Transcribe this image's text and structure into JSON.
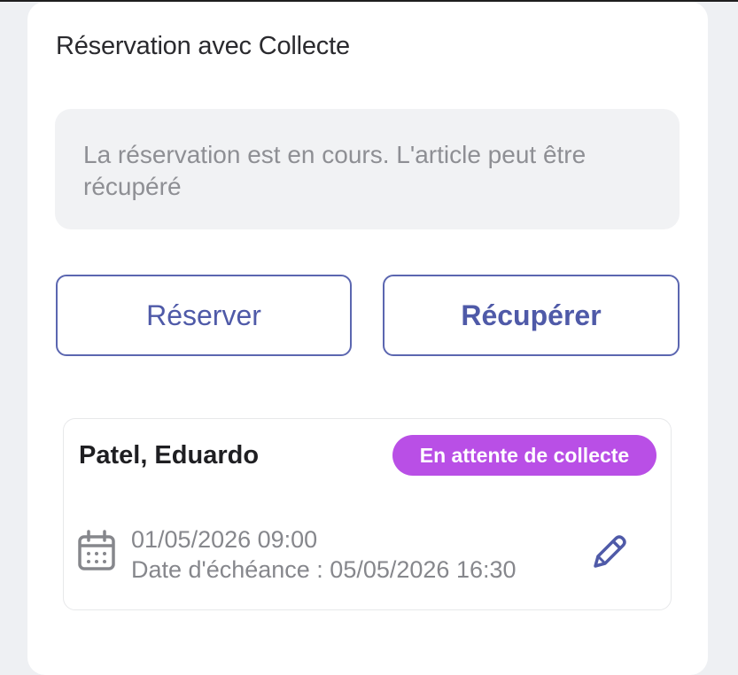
{
  "panel": {
    "title": "Réservation avec Collecte",
    "info_message": "La réservation est en cours. L'article peut être récupéré"
  },
  "actions": {
    "reserve_label": "Réserver",
    "collect_label": "Récupérer"
  },
  "reservation": {
    "name": "Patel, Eduardo",
    "status": "En attente de collecte",
    "date": "01/05/2026 09:00",
    "due": "Date d'échéance : 05/05/2026 16:30"
  },
  "icons": {
    "calendar": "calendar-icon",
    "edit": "pencil-icon"
  },
  "colors": {
    "accent": "#4f5aa8",
    "status_badge": "#b94fe6"
  }
}
